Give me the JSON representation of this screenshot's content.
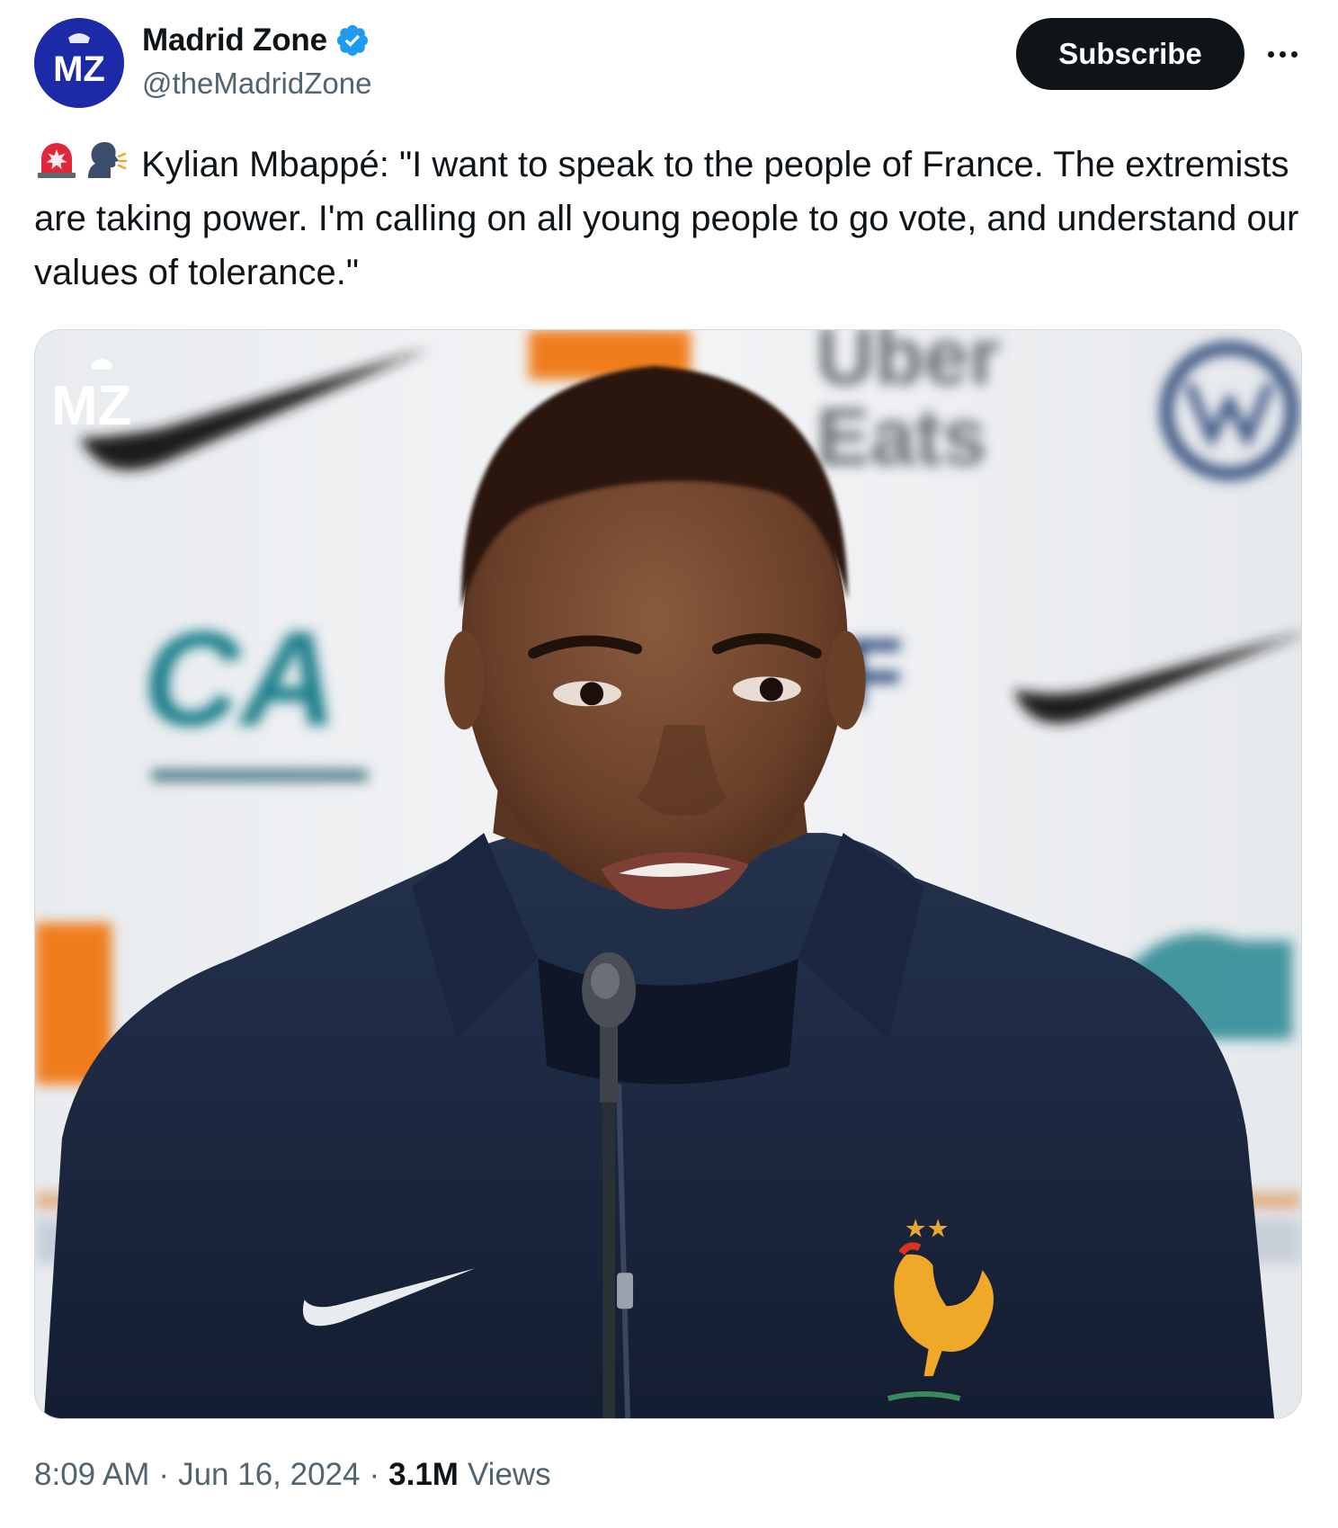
{
  "author": {
    "display_name": "Madrid Zone",
    "handle": "@theMadridZone",
    "avatar_text": "MZ",
    "verified_icon": "verified-badge-icon"
  },
  "actions": {
    "subscribe_label": "Subscribe",
    "more_icon": "more-options-icon"
  },
  "tweet": {
    "emojis": [
      "police-light-emoji",
      "speaking-head-emoji"
    ],
    "text": "Kylian Mbappé: \"I want to speak to the people of France. The extremists are taking power. I'm calling on all young people to go vote, and understand our values of tolerance.\""
  },
  "media": {
    "watermark": "MZ",
    "sponsor_text": [
      "Uber",
      "Eats"
    ],
    "sponsor_fragment": "F",
    "sponsor_logo": "CA"
  },
  "meta": {
    "time": "8:09 AM",
    "date": "Jun 16, 2024",
    "views_count": "3.1M",
    "views_label": "Views"
  },
  "colors": {
    "text_primary": "#0f1419",
    "text_secondary": "#536471",
    "verified_blue": "#1d9bf0",
    "avatar_blue": "#1d2aa8"
  }
}
